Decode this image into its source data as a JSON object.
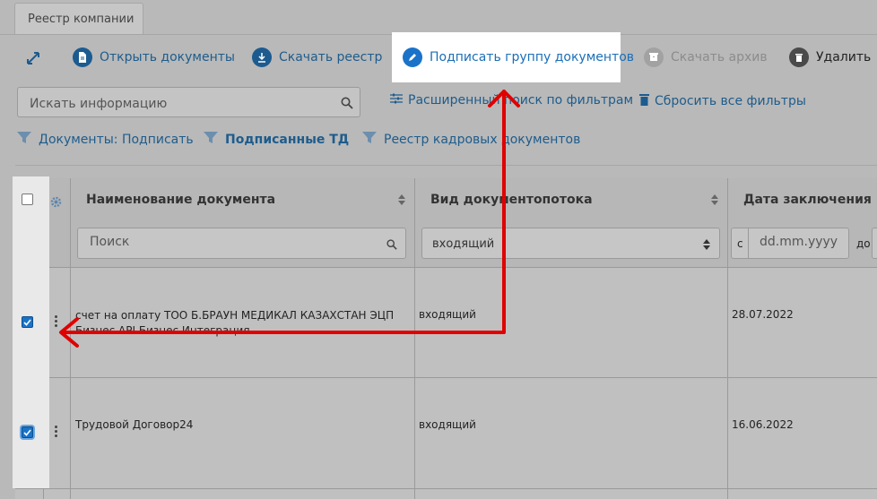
{
  "tab": {
    "label": "Реестр компании"
  },
  "toolbar": {
    "open_docs": "Открыть документы",
    "download_registry": "Скачать реестр",
    "sign_group": "Подписать группу документов",
    "download_archive": "Скачать архив",
    "delete": "Удалить"
  },
  "search": {
    "placeholder": "Искать информацию",
    "advanced": "Расширенный поиск по фильтрам",
    "reset": "Сбросить все фильтры"
  },
  "filters": [
    {
      "label": "Документы: Подписать"
    },
    {
      "label": "Подписанные ТД"
    },
    {
      "label": "Реестр кадровых документов"
    }
  ],
  "table": {
    "columns": [
      "Наименование документа",
      "Вид документопотока",
      "Дата заключения"
    ],
    "filter": {
      "name_placeholder": "Поиск",
      "flow_value": "входящий",
      "date_from_label": "с",
      "date_placeholder": "dd.mm.yyyy",
      "date_to_label": "до"
    },
    "rows": [
      {
        "name": "счет на оплату ТОО Б.БРАУН МЕДИКАЛ КАЗАХСТАН ЭЦП Бизнес API Бизнес Интеграция",
        "flow": "входящий",
        "date": "28.07.2022"
      },
      {
        "name": "Трудовой Договор24",
        "flow": "входящий",
        "date": "16.06.2022"
      }
    ]
  },
  "colors": {
    "accent": "#1c5b8f",
    "annotation": "#e00000"
  }
}
